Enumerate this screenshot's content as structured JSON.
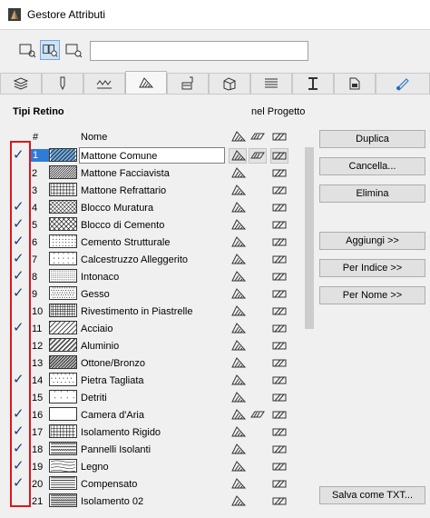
{
  "window": {
    "title": "Gestore Attributi"
  },
  "search": {
    "value": "",
    "placeholder": ""
  },
  "tabs": [
    {
      "icon": "layers-icon"
    },
    {
      "icon": "pen-icon"
    },
    {
      "icon": "line-type-icon"
    },
    {
      "icon": "fill-icon",
      "active": true
    },
    {
      "icon": "building-material-icon"
    },
    {
      "icon": "composite-icon"
    },
    {
      "icon": "profile-icon"
    },
    {
      "icon": "column-icon"
    },
    {
      "icon": "zone-icon"
    },
    {
      "icon": "surface-icon"
    }
  ],
  "section": {
    "title": "Tipi Retino",
    "in_project_label": "nel Progetto"
  },
  "table": {
    "col_num": "#",
    "col_name": "Nome",
    "rows": [
      {
        "checked": true,
        "num": "1",
        "name": "Mattone Comune",
        "selected": true,
        "pattern": "diag-light",
        "surface": true
      },
      {
        "checked": false,
        "num": "2",
        "name": "Mattone Facciavista",
        "pattern": "diag-dense"
      },
      {
        "checked": false,
        "num": "3",
        "name": "Mattone Refrattario",
        "pattern": "grid"
      },
      {
        "checked": true,
        "num": "4",
        "name": "Blocco Muratura",
        "pattern": "diag-grid"
      },
      {
        "checked": true,
        "num": "5",
        "name": "Blocco di Cemento",
        "pattern": "cross"
      },
      {
        "checked": true,
        "num": "6",
        "name": "Cemento Strutturale",
        "pattern": "dots"
      },
      {
        "checked": true,
        "num": "7",
        "name": "Calcestruzzo Alleggerito",
        "pattern": "dots-large"
      },
      {
        "checked": true,
        "num": "8",
        "name": "Intonaco",
        "pattern": "fine"
      },
      {
        "checked": true,
        "num": "9",
        "name": "Gesso",
        "pattern": "fine-dots"
      },
      {
        "checked": false,
        "num": "10",
        "name": "Rivestimento in Piastrelle",
        "pattern": "grid-small"
      },
      {
        "checked": true,
        "num": "11",
        "name": "Acciaio",
        "pattern": "diag-sparse"
      },
      {
        "checked": false,
        "num": "12",
        "name": "Aluminio",
        "pattern": "diag-double"
      },
      {
        "checked": false,
        "num": "13",
        "name": "Ottone/Bronzo",
        "pattern": "diag-triple"
      },
      {
        "checked": true,
        "num": "14",
        "name": "Pietra Tagliata",
        "pattern": "stone"
      },
      {
        "checked": false,
        "num": "15",
        "name": "Detriti",
        "pattern": "sparse-dots"
      },
      {
        "checked": true,
        "num": "16",
        "name": "Camera d'Aria",
        "pattern": "empty",
        "surface": true
      },
      {
        "checked": true,
        "num": "17",
        "name": "Isolamento Rigido",
        "pattern": "grid"
      },
      {
        "checked": true,
        "num": "18",
        "name": "Pannelli Isolanti",
        "pattern": "zigzag"
      },
      {
        "checked": true,
        "num": "19",
        "name": "Legno",
        "pattern": "wood"
      },
      {
        "checked": true,
        "num": "20",
        "name": "Compensato",
        "pattern": "horiz"
      },
      {
        "checked": false,
        "num": "21",
        "name": "Isolamento 02",
        "pattern": "zigzag2"
      }
    ]
  },
  "buttons": {
    "duplicate": "Duplica",
    "delete": "Cancella...",
    "remove": "Elimina",
    "append": "Aggiungi >>",
    "by_index": "Per Indice >>",
    "by_name": "Per Nome >>",
    "save_txt": "Salva come TXT..."
  },
  "colors": {
    "selection": "#2f7bd8",
    "highlight_box": "#e0141a",
    "check": "#1f3b73"
  }
}
